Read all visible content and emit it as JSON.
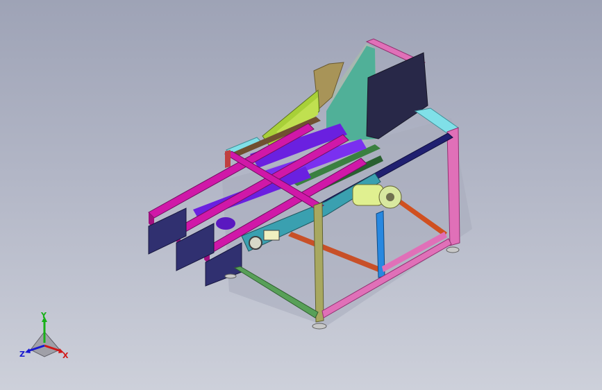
{
  "viewport": {
    "background_top": "#9ea3b6",
    "background_bottom": "#cdd0da"
  },
  "triad": {
    "x_label": "X",
    "y_label": "Y",
    "z_label": "Z",
    "x_color": "#d01818",
    "y_color": "#18b018",
    "z_color": "#1818d0"
  },
  "model": {
    "name_icon": "conveyor-machine-3d-model",
    "colors": {
      "frame_olive": "#a8a860",
      "frame_pink": "#e070b8",
      "frame_green": "#58a058",
      "frame_orange": "#d05020",
      "frame_blue": "#2888e0",
      "frame_red": "#c04040",
      "frame_cyan": "#80e0e8",
      "rail_magenta": "#d018a8",
      "rail_magenta_dark": "#a01080",
      "guard_navy": "#303070",
      "roller_purple": "#6a20e0",
      "belt_teal": "#3aa0b0",
      "motor_yellow": "#e0f090",
      "hopper_lime": "#a8d038",
      "hopper_teal": "#50b098",
      "hopper_tan": "#a89458",
      "hopper_gray": "#a8b8b0",
      "panel_dark": "#282848",
      "top_bar_navy": "#202070",
      "top_bar_brown": "#705030"
    }
  }
}
